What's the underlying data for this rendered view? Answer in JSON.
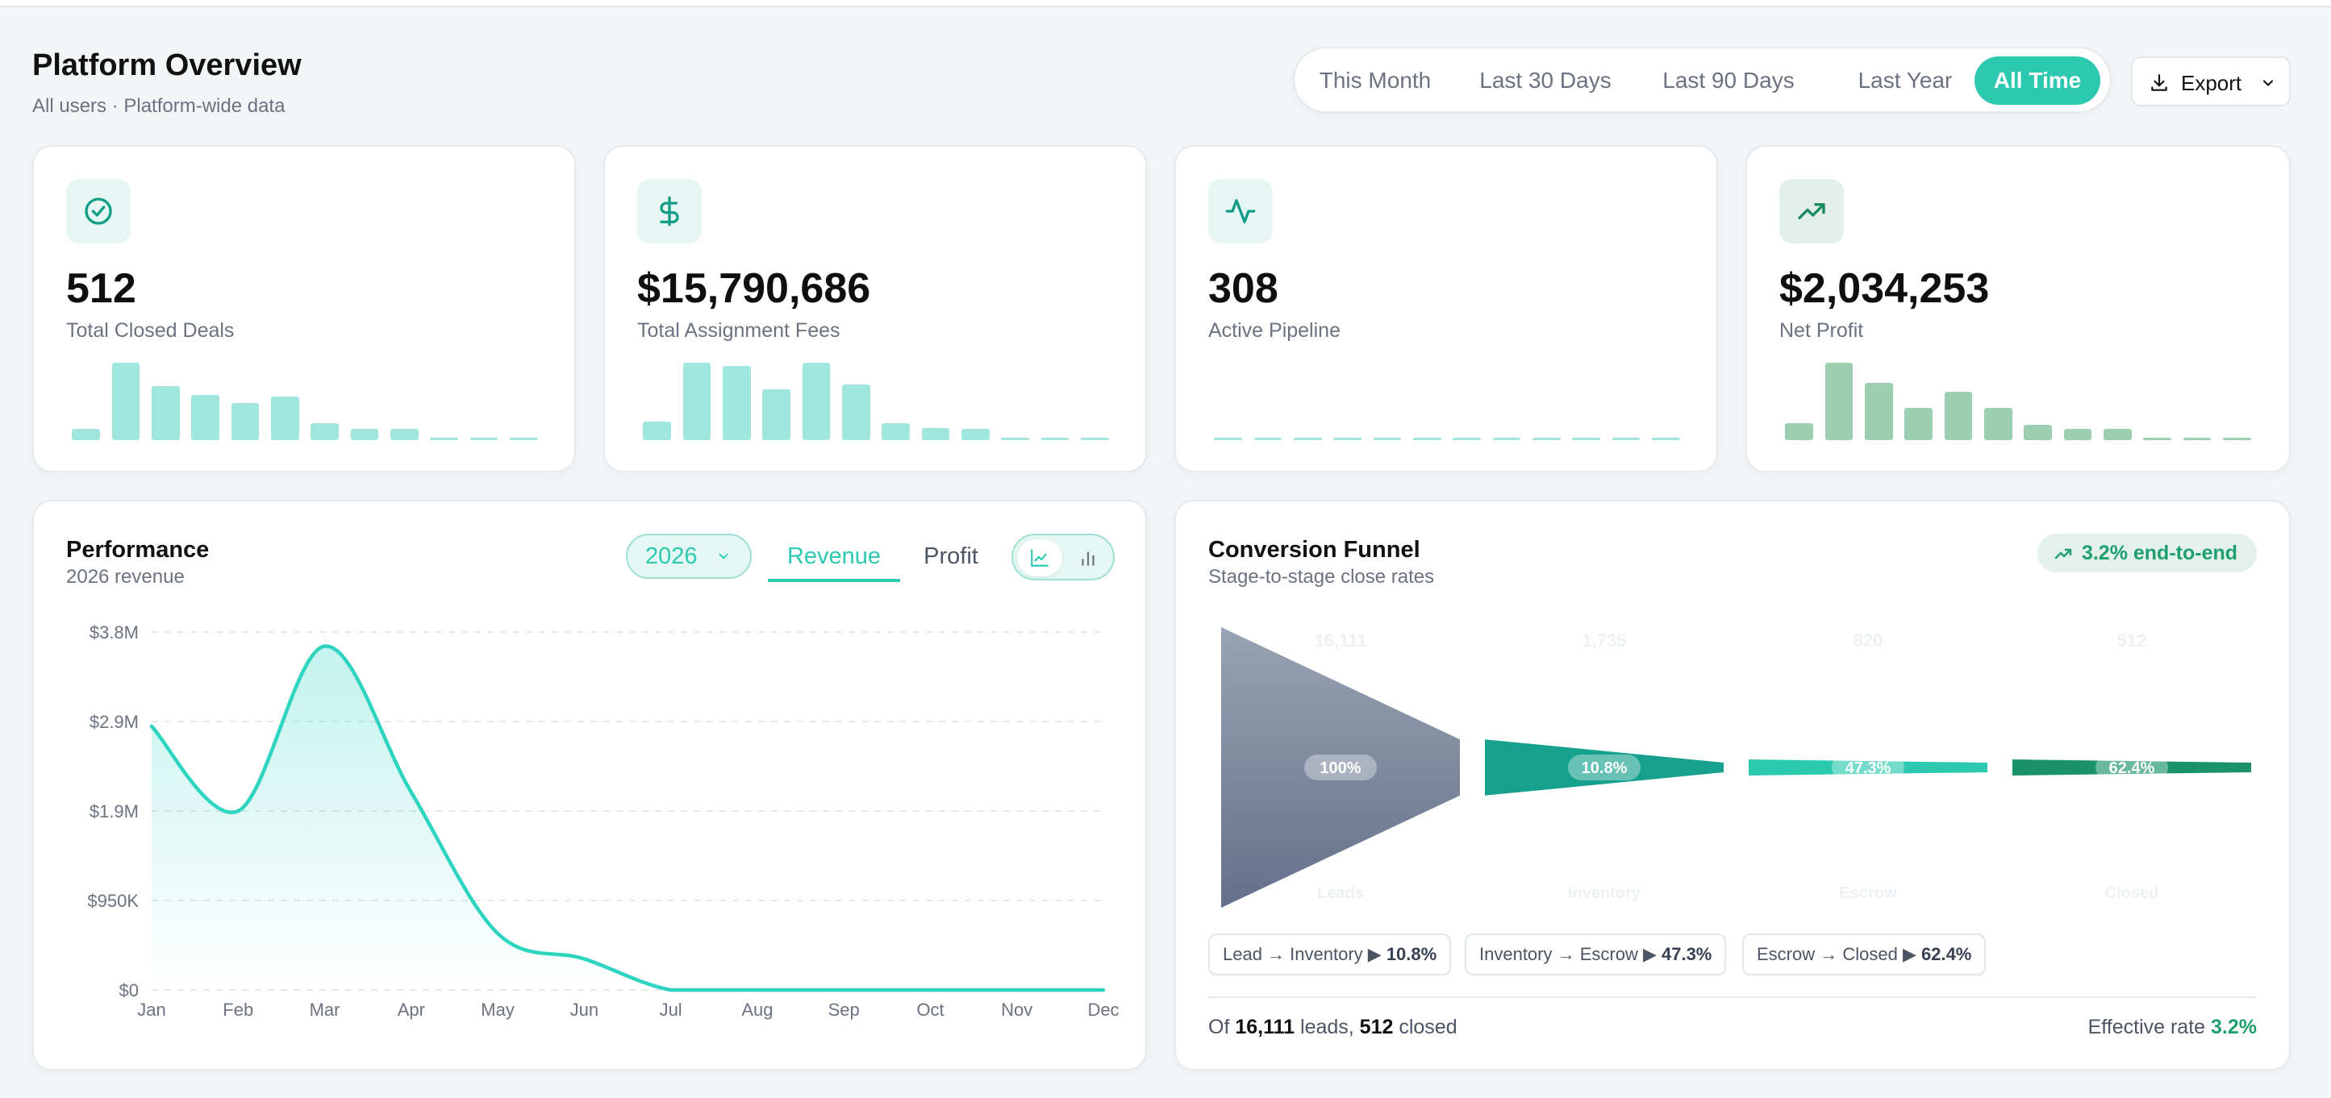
{
  "header": {
    "title": "Platform Overview",
    "subtitle": "All users · Platform-wide data",
    "ranges": [
      "This Month",
      "Last 30 Days",
      "Last 90 Days",
      "Last Year",
      "All Time"
    ],
    "active_range": "All Time",
    "export_label": "Export"
  },
  "kpis": [
    {
      "icon": "check-circle-icon",
      "value": "512",
      "label": "Total Closed Deals",
      "spark": [
        0.15,
        1.0,
        0.7,
        0.58,
        0.48,
        0.56,
        0.22,
        0.15,
        0.15,
        0.02,
        0.02,
        0.02
      ],
      "color": "#9fe6dc"
    },
    {
      "icon": "dollar-icon",
      "value": "$15,790,686",
      "label": "Total Assignment Fees",
      "spark": [
        0.24,
        1.0,
        0.96,
        0.66,
        1.0,
        0.72,
        0.22,
        0.16,
        0.15,
        0.02,
        0.02,
        0.02
      ],
      "color": "#9fe6dc"
    },
    {
      "icon": "activity-icon",
      "value": "308",
      "label": "Active Pipeline",
      "spark": [
        0.02,
        0.02,
        0.02,
        0.02,
        0.02,
        0.02,
        0.02,
        0.02,
        0.02,
        0.02,
        0.02,
        0.02
      ],
      "color": "#9fe6dc"
    },
    {
      "icon": "trending-up-icon",
      "value": "$2,034,253",
      "label": "Net Profit",
      "spark": [
        0.22,
        1.0,
        0.74,
        0.42,
        0.62,
        0.42,
        0.2,
        0.15,
        0.15,
        0.02,
        0.02,
        0.02
      ],
      "color": "#9ccfb0"
    }
  ],
  "performance": {
    "title": "Performance",
    "subtitle": "2026 revenue",
    "year": "2026",
    "tabs": [
      "Revenue",
      "Profit"
    ],
    "active_tab": "Revenue"
  },
  "chart_data": {
    "type": "area",
    "title": "",
    "xlabel": "",
    "ylabel": "",
    "x": [
      "Jan",
      "Feb",
      "Mar",
      "Apr",
      "May",
      "Jun",
      "Jul",
      "Aug",
      "Sep",
      "Oct",
      "Nov",
      "Dec"
    ],
    "series": [
      {
        "values": [
          2800000,
          1900000,
          3650000,
          2100000,
          600000,
          330000,
          0,
          0,
          0,
          0,
          0,
          0
        ]
      }
    ],
    "yticks": [
      "$3.8M",
      "$2.9M",
      "$1.9M",
      "$950K",
      "$0"
    ],
    "ylim": [
      0,
      3800000
    ],
    "grid": true,
    "color": "#2dd4bf"
  },
  "funnel": {
    "title": "Conversion Funnel",
    "subtitle": "Stage-to-stage close rates",
    "end_to_end_badge": "3.2% end-to-end",
    "stage_counts": [
      "16,111",
      "1,735",
      "820",
      "512"
    ],
    "stage_names": [
      "Leads",
      "Inventory",
      "Escrow",
      "Closed"
    ],
    "stage_pcts": [
      "100%",
      "10.8%",
      "47.3%",
      "62.4%"
    ],
    "stage_values": [
      100,
      10.8,
      47.3,
      62.4
    ],
    "stage_colors": [
      "#7a8699",
      "#16a08e",
      "#2cc9b0",
      "#1a936a"
    ],
    "rates": [
      {
        "text": "Lead → Inventory ▶ ",
        "value": "10.8%"
      },
      {
        "text": "Inventory → Escrow ▶ ",
        "value": "47.3%"
      },
      {
        "text": "Escrow → Closed ▶ ",
        "value": "62.4%"
      }
    ],
    "footer": {
      "prefix": "Of ",
      "leads": "16,111",
      "middle": " leads, ",
      "closed": "512",
      "suffix": " closed",
      "effective_label": "Effective rate ",
      "effective_value": "3.2%"
    }
  }
}
